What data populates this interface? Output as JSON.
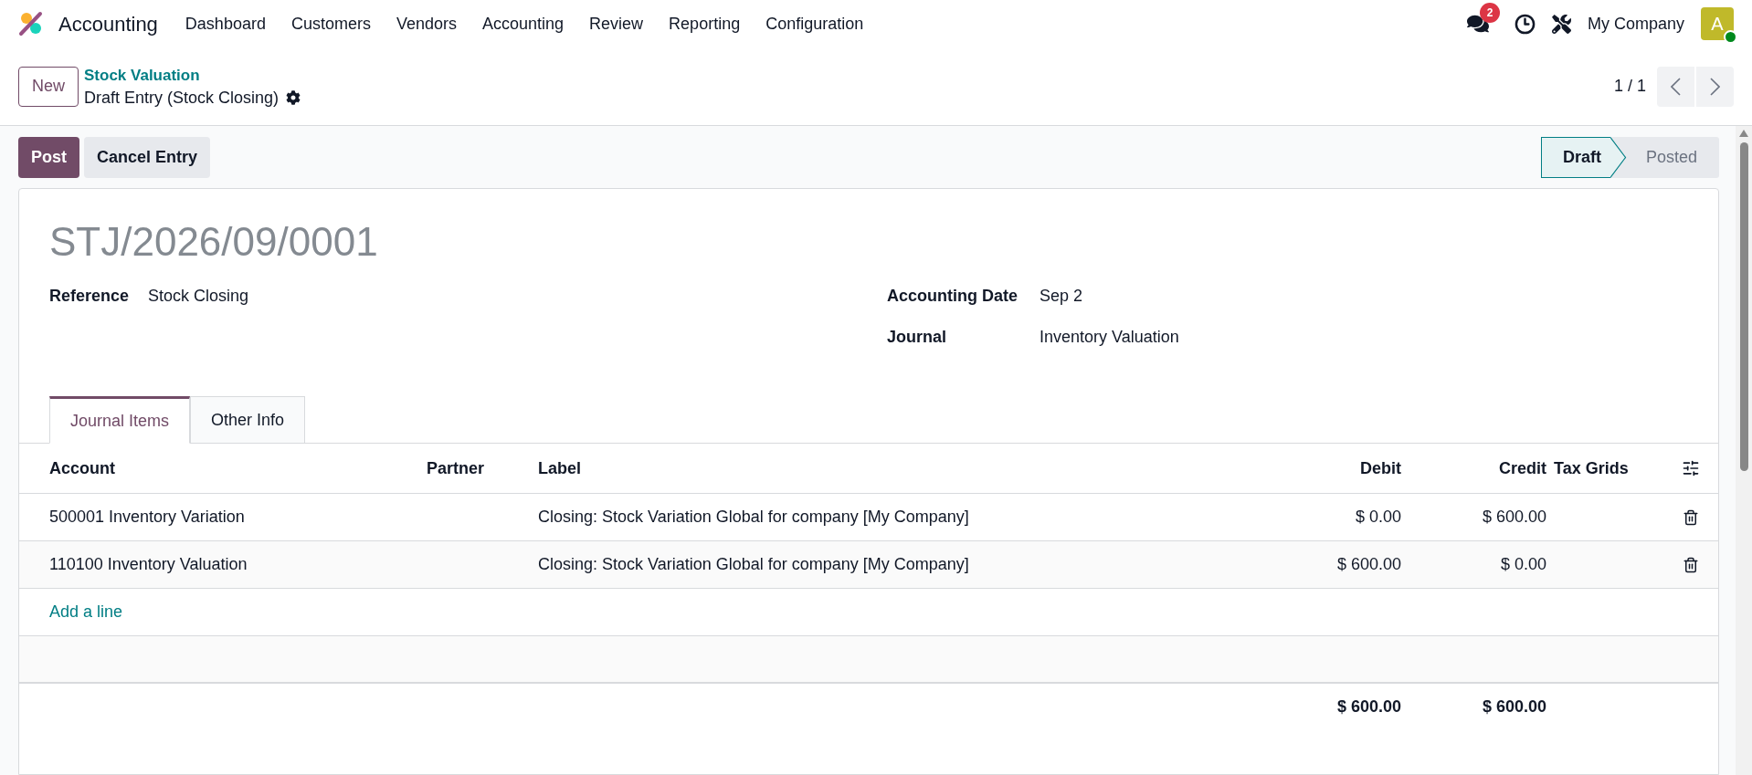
{
  "navbar": {
    "app_name": "Accounting",
    "menu": [
      "Dashboard",
      "Customers",
      "Vendors",
      "Accounting",
      "Review",
      "Reporting",
      "Configuration"
    ],
    "message_count": "2",
    "company": "My Company",
    "avatar_letter": "A"
  },
  "control_panel": {
    "new_button": "New",
    "breadcrumb": "Stock Valuation",
    "record": "Draft Entry (Stock Closing)",
    "pager": "1 / 1"
  },
  "actions": [
    {
      "label": "Post",
      "kind": "primary"
    },
    {
      "label": "Cancel Entry",
      "kind": "secondary"
    }
  ],
  "statusbar": [
    {
      "label": "Draft",
      "selected": true
    },
    {
      "label": "Posted",
      "selected": false
    }
  ],
  "form": {
    "title": "STJ/2026/09/0001",
    "left_fields": [
      {
        "label": "Reference",
        "value": "Stock Closing"
      }
    ],
    "right_fields": [
      {
        "label": "Accounting Date",
        "value": "Sep 2"
      },
      {
        "label": "Journal",
        "value": "Inventory Valuation"
      }
    ]
  },
  "tabs": [
    {
      "label": "Journal Items",
      "selected": true
    },
    {
      "label": "Other Info",
      "selected": false
    }
  ],
  "table": {
    "columns": [
      {
        "label": "Account",
        "kind": "text"
      },
      {
        "label": "Partner",
        "kind": "text"
      },
      {
        "label": "Label",
        "kind": "text"
      },
      {
        "label": "Debit",
        "kind": "amount"
      },
      {
        "label": "Credit",
        "kind": "amount"
      },
      {
        "label": "Tax Grids",
        "kind": "text"
      }
    ],
    "rows": [
      {
        "account": "500001 Inventory Variation",
        "label": "Closing: Stock Variation Global for company [My Company]",
        "debit": "$ 0.00",
        "credit": "$ 600.00"
      },
      {
        "account": "110100 Inventory Valuation",
        "label": "Closing: Stock Variation Global for company [My Company]",
        "debit": "$ 600.00",
        "credit": "$ 0.00"
      }
    ],
    "add_line": "Add a line",
    "totals": {
      "debit": "$ 600.00",
      "credit": "$ 600.00"
    }
  }
}
